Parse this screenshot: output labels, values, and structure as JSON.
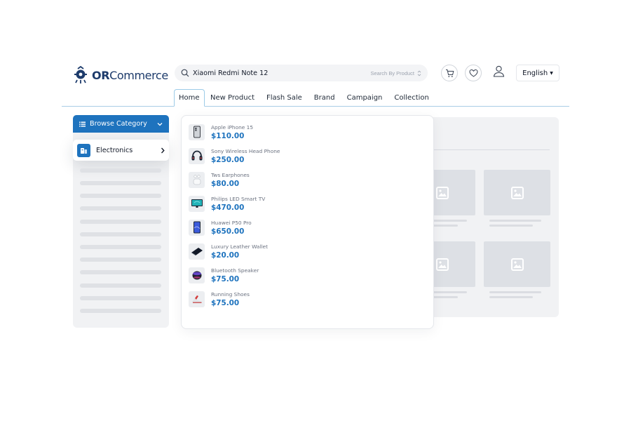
{
  "brand": {
    "logo_prefix": "OR",
    "logo_suffix": "Commerce"
  },
  "search": {
    "value": "Xiaomi Redmi Note 12",
    "scope_label": "Search By Product"
  },
  "header": {
    "language": "English"
  },
  "nav": {
    "items": [
      {
        "label": "Home",
        "active": true
      },
      {
        "label": "New Product",
        "active": false
      },
      {
        "label": "Flash Sale",
        "active": false
      },
      {
        "label": "Brand",
        "active": false
      },
      {
        "label": "Campaign",
        "active": false
      },
      {
        "label": "Collection",
        "active": false
      }
    ]
  },
  "sidebar": {
    "browse_label": "Browse Category",
    "selected_category": "Electronics"
  },
  "results": [
    {
      "name": "Apple iPhone 15",
      "price": "$110.00",
      "icon": "phone-icon"
    },
    {
      "name": "Sony Wireless Head Phone",
      "price": "$250.00",
      "icon": "headphone-icon"
    },
    {
      "name": "Tws Earphones",
      "price": "$80.00",
      "icon": "earphones-icon"
    },
    {
      "name": "Philips LED Smart TV",
      "price": "$470.00",
      "icon": "tv-icon"
    },
    {
      "name": "Huawei P50 Pro",
      "price": "$650.00",
      "icon": "phone-icon"
    },
    {
      "name": "Luxury Leather Wallet",
      "price": "$20.00",
      "icon": "wallet-icon"
    },
    {
      "name": "Bluetooth Speaker",
      "price": "$75.00",
      "icon": "speaker-icon"
    },
    {
      "name": "Running Shoes",
      "price": "$75.00",
      "icon": "shoe-icon"
    }
  ],
  "colors": {
    "primary": "#1e73be",
    "brand_dark": "#1d3b6b",
    "price": "#1e73be",
    "skeleton": "#dfe1e5"
  }
}
